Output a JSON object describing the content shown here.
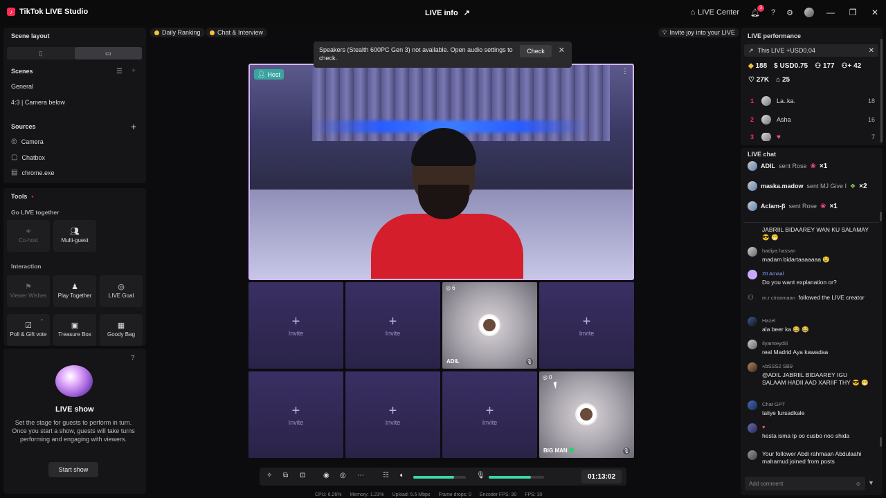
{
  "app": {
    "title": "TikTok LIVE Studio",
    "center_title": "LIVE info"
  },
  "titlebar": {
    "live_center": "LIVE Center",
    "notif_count": "3"
  },
  "left": {
    "scene_layout": "Scene layout",
    "scenes_title": "Scenes",
    "scenes": [
      "General",
      "4:3 | Camera below"
    ],
    "sources_title": "Sources",
    "sources": [
      "Camera",
      "Chatbox",
      "chrome.exe"
    ],
    "tools_title": "Tools",
    "go_live_together": "Go LIVE together",
    "cohost": "Co-host",
    "multiguest": "Multi-guest",
    "interaction": "Interaction",
    "viewer_wishes": "Viewer Wishes",
    "play_together": "Play Together",
    "live_goal": "LIVE Goal",
    "poll_gift": "Poll & Gift vote",
    "treasure_box": "Treasure Box",
    "goody_bag": "Goody Bag",
    "show_title": "LIVE show",
    "show_desc": "Set the stage for guests to perform in turn. Once you start a show, guests will take turns performing and engaging with viewers.",
    "start_show": "Start show"
  },
  "center": {
    "daily_ranking": "Daily Ranking",
    "chat_interview": "Chat & Interview",
    "invite_joy": "Invite joy into your LIVE",
    "toast": "Speakers (Stealth 600PC Gen 3) not available. Open audio settings to check.",
    "toast_check": "Check",
    "host": "Host",
    "invite": "Invite",
    "guest1": {
      "name": "ADIL",
      "count": "6"
    },
    "guest2": {
      "name": "BIG MAN",
      "count": "0"
    },
    "timer": "01:13:02",
    "mic_level": 0.76,
    "volume_level": 0.77,
    "stats": [
      "CPU: 6.26%",
      "Memory: 1.23%",
      "Upload: 5.5 Mbps",
      "Frame drops: 0",
      "Encoder FPS: 30",
      "FPS: 30"
    ]
  },
  "right": {
    "perf_title": "LIVE performance",
    "banner": "This LIVE +USD0.04",
    "stats1": [
      "188",
      "USD0.75",
      "177",
      "42"
    ],
    "stats2": [
      "27K",
      "25"
    ],
    "ranks": [
      {
        "n": "1",
        "name": "La..ka.",
        "v": "18"
      },
      {
        "n": "2",
        "name": "Asha",
        "v": "16"
      },
      {
        "n": "3",
        "name": "",
        "v": "7"
      }
    ],
    "chat_title": "LIVE chat",
    "gifts": [
      {
        "user": "ADIL",
        "action": "sent Rose",
        "count": "×1"
      },
      {
        "user": "maska.madow",
        "action": "sent MJ Give I",
        "count": "×2"
      },
      {
        "user": "Aclam-β",
        "action": "sent Rose",
        "count": "×1"
      }
    ],
    "messages": [
      {
        "who": "",
        "txt": "JABRIIL BIDAAREY WAN KU SALAMAY 😎 😁"
      },
      {
        "who": "hadiya hassan",
        "txt": "madam bidartaaaaaaa 😢"
      },
      {
        "who": "20 Amaal",
        "txt": "Do you want explanation or?"
      },
      {
        "who": "m.r c/raxmaan",
        "txt": "followed the LIVE creator"
      },
      {
        "who": "Hazel",
        "txt": "ala beer ka 😂 😂"
      },
      {
        "who": "Ilyamteydiii",
        "txt": "real Madrid Aya kawadaa"
      },
      {
        "who": "ኣbSSS2 SB9",
        "txt": "@ADIL JABRIIL BIDAAREY IGU SALAAM HADII AAD XARIIF THY 😎 😁"
      },
      {
        "who": "Chat GPT",
        "txt": "taliye fursadkale"
      },
      {
        "who": "",
        "txt": "hesta isma lp oo cusbo noo shida"
      },
      {
        "who": "",
        "txt": "Your follower Abdi rahmaan Abdulaahi mahamud joined from posts"
      }
    ],
    "add_comment": "Add comment"
  }
}
